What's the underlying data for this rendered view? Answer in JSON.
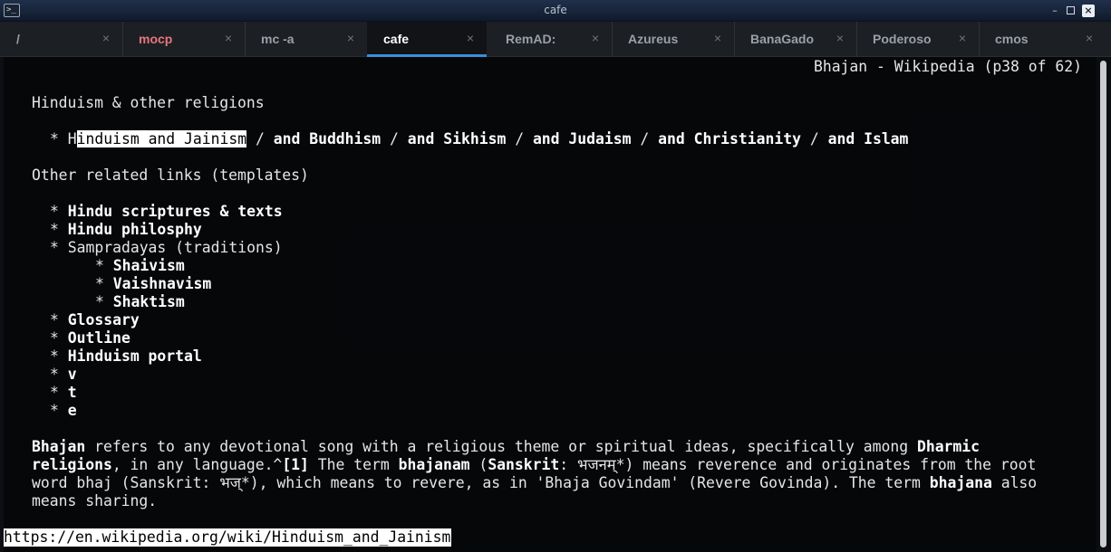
{
  "window": {
    "title": "cafe",
    "minimize_label": "–",
    "close_label": "×"
  },
  "tabs": [
    {
      "label": "/",
      "close": "×"
    },
    {
      "label": "mocp",
      "close": "×"
    },
    {
      "label": "mc -a",
      "close": "×"
    },
    {
      "label": "cafe",
      "close": "×"
    },
    {
      "label": "RemAD:",
      "close": "×"
    },
    {
      "label": "Azureus",
      "close": "×"
    },
    {
      "label": "BanaGado",
      "close": "×"
    },
    {
      "label": "Poderoso",
      "close": "×"
    },
    {
      "label": "cmos",
      "close": "×"
    }
  ],
  "terminal": {
    "header": "Bhajan - Wikipedia (p38 of 62)",
    "section1_title": "Hinduism & other religions",
    "religions": {
      "bullet": "* ",
      "first_char": "H",
      "selected_link": "induism and Jainism",
      "sep": " / ",
      "links": [
        "and Buddhism",
        "and Sikhism",
        "and Judaism",
        "and Christianity",
        "and Islam"
      ]
    },
    "section2_title": "Other related links (templates)",
    "related": {
      "bullet": "* ",
      "scriptures": "Hindu scriptures & texts",
      "philosophy": "Hindu philosphy",
      "sampradayas": "Sampradayas (traditions)",
      "shaivism": "Shaivism",
      "vaishnavism": "Vaishnavism",
      "shaktism": "Shaktism",
      "glossary": "Glossary",
      "outline": "Outline",
      "portal": "Hinduism portal",
      "v": "v",
      "t": "t",
      "e": "e"
    },
    "para": {
      "l1_bhajan": "Bhajan",
      "l1_text": " refers to any devotional song with a religious theme or spiritual ideas, specifically among ",
      "l1_dharmic": "Dharmic",
      "l2_religions": "religions",
      "l2_text1": ", in any language.^",
      "l2_ref": "[1]",
      "l2_text2": " The term ",
      "l2_bhajanam": "bhajanam",
      "l2_text3": " (",
      "l2_sanskrit": "Sanskrit",
      "l2_text4": ": भजनम्*) means reverence and originates from the root",
      "l3_text1": "word bhaj (Sanskrit: भज्*), which means to revere, as in 'Bhaja Govindam' (Revere Govinda). The term ",
      "l3_bhajana": "bhajana",
      "l3_text2": " also",
      "l4_text": "means sharing."
    },
    "status_url": "https://en.wikipedia.org/wiki/Hinduism_and_Jainism"
  }
}
